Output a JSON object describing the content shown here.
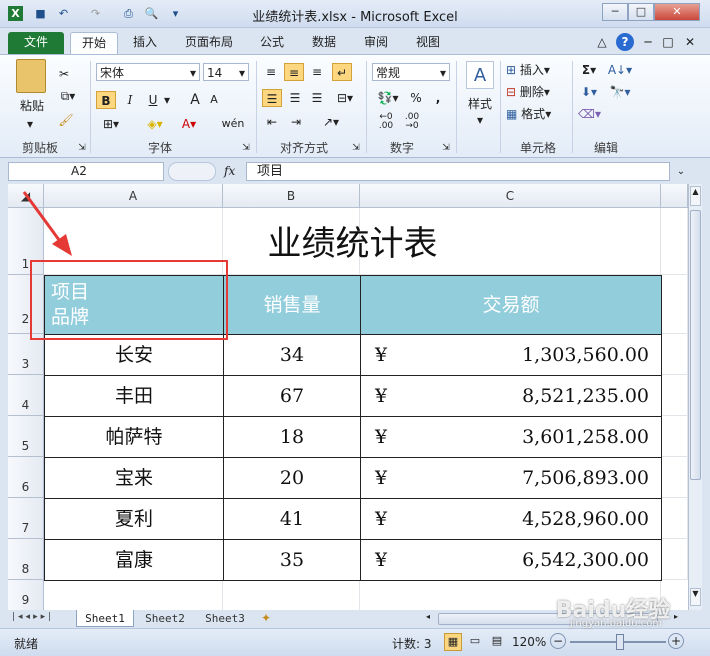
{
  "window": {
    "title": "业绩统计表.xlsx - Microsoft Excel",
    "btn_min": "─",
    "btn_max": "□",
    "btn_close": "✕",
    "btn_help": "?",
    "ribbon_min": "△"
  },
  "tabs": [
    "文件",
    "开始",
    "插入",
    "页面布局",
    "公式",
    "数据",
    "审阅",
    "视图"
  ],
  "ribbon": {
    "clipboard": {
      "label": "剪贴板",
      "paste": "粘贴"
    },
    "font": {
      "label": "字体",
      "name": "宋体",
      "size": "14",
      "bold": "B",
      "italic": "I",
      "underline": "U",
      "grow": "A",
      "shrink": "A",
      "font_color": "A",
      "wen": "wén"
    },
    "align": {
      "label": "对齐方式"
    },
    "number": {
      "label": "数字",
      "format": "常规",
      "percent": "%",
      "comma": ","
    },
    "styles": {
      "label": "样式"
    },
    "cells": {
      "label": "单元格",
      "insert": "插入",
      "delete": "删除",
      "format": "格式"
    },
    "edit": {
      "label": "编辑",
      "sum": "Σ"
    }
  },
  "formula_bar": {
    "name_box": "A2",
    "fx": "fx",
    "content": "项目"
  },
  "sheet": {
    "columns": [
      "A",
      "B",
      "C"
    ],
    "rows": [
      "1",
      "2",
      "3",
      "4",
      "5",
      "6",
      "7",
      "8",
      "9"
    ],
    "title": "业绩统计表",
    "header": {
      "a_line1": "项目",
      "a_line2": "品牌",
      "b": "销售量",
      "c": "交易额"
    },
    "data": [
      {
        "brand": "长安",
        "qty": "34",
        "cur": "¥",
        "amt": "1,303,560.00"
      },
      {
        "brand": "丰田",
        "qty": "67",
        "cur": "¥",
        "amt": "8,521,235.00"
      },
      {
        "brand": "帕萨特",
        "qty": "18",
        "cur": "¥",
        "amt": "3,601,258.00"
      },
      {
        "brand": "宝来",
        "qty": "20",
        "cur": "¥",
        "amt": "7,506,893.00"
      },
      {
        "brand": "夏利",
        "qty": "41",
        "cur": "¥",
        "amt": "4,528,960.00"
      },
      {
        "brand": "富康",
        "qty": "35",
        "cur": "¥",
        "amt": "6,542,300.00"
      }
    ]
  },
  "sheet_tabs": [
    "Sheet1",
    "Sheet2",
    "Sheet3"
  ],
  "status": {
    "ready": "就绪",
    "count": "计数: 3",
    "zoom": "120%",
    "minus": "−",
    "plus": "+"
  },
  "watermark": {
    "text": "Baidu经验",
    "sub": "jingyan.baidu.com"
  },
  "colors": {
    "header_fill": "#92cddc",
    "annotation": "#e53935",
    "file_tab": "#1e7a34"
  }
}
